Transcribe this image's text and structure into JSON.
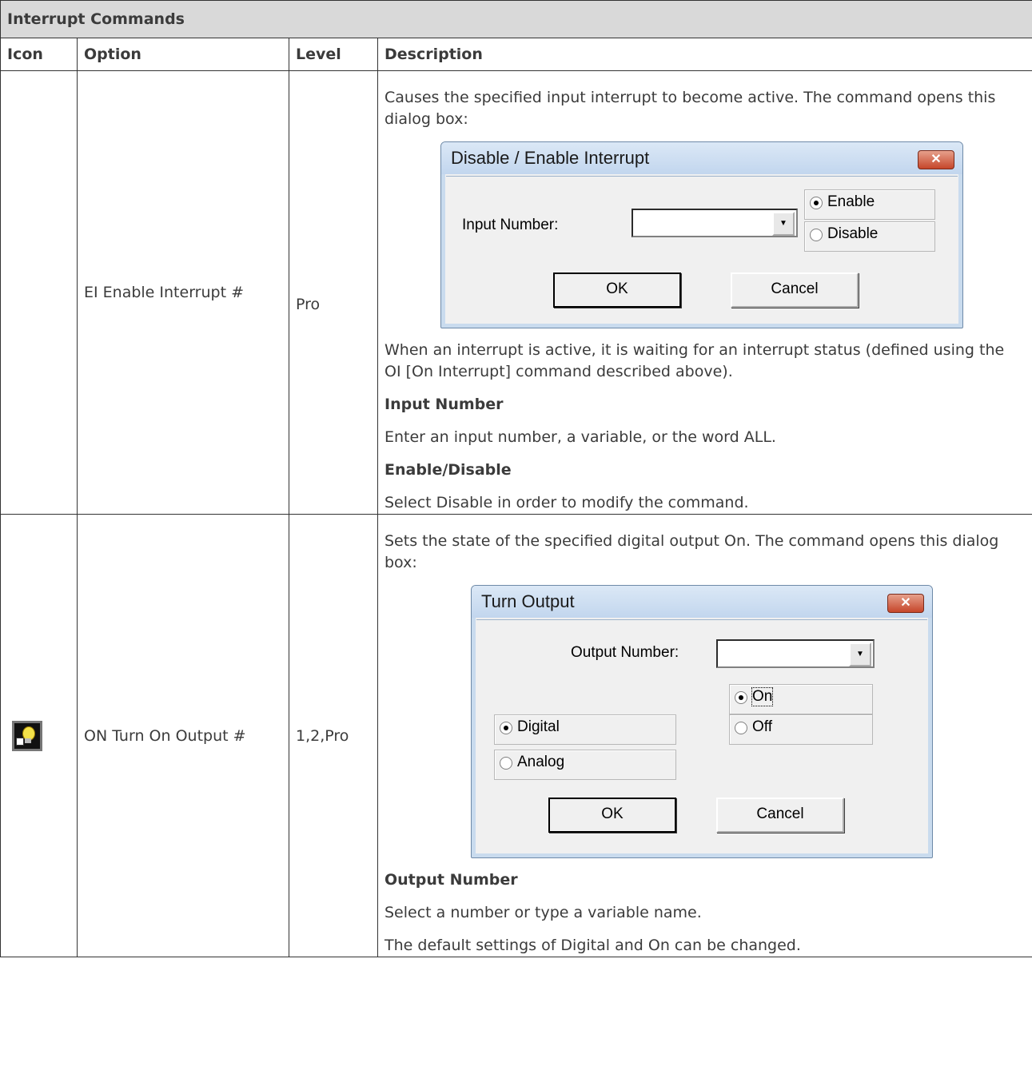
{
  "section_title": "Interrupt Commands",
  "headers": {
    "icon": "Icon",
    "option": "Option",
    "level": "Level",
    "description": "Description"
  },
  "rows": [
    {
      "option": "EI Enable Interrupt #",
      "level": "Pro",
      "intro": "Causes the specified input interrupt to become active. The command opens this dialog box:",
      "dialog": {
        "title": "Disable / Enable Interrupt",
        "close": "✕",
        "input_label": "Input Number:",
        "input_value": "",
        "enable": "Enable",
        "disable": "Disable",
        "ok": "OK",
        "cancel": "Cancel",
        "selected": "Enable"
      },
      "after": "When an interrupt is active, it is waiting for an interrupt status (defined using the OI [On Interrupt] command described above).",
      "h1": "Input Number",
      "p1": "Enter an input number, a variable, or the word ALL.",
      "h2": "Enable/Disable",
      "p2": "Select Disable in order to modify the command."
    },
    {
      "icon": "lightbulb-icon",
      "option": "ON Turn On Output #",
      "level": "1,2,Pro",
      "intro": "Sets the state of the specified digital output On. The command opens this dialog box:",
      "dialog": {
        "title": "Turn Output",
        "close": "✕",
        "output_label": "Output Number:",
        "output_value": "",
        "on": "On",
        "off": "Off",
        "digital": "Digital",
        "analog": "Analog",
        "ok": "OK",
        "cancel": "Cancel",
        "selected_state": "On",
        "selected_type": "Digital"
      },
      "h1": "Output Number",
      "p1": "Select a number or type a variable name.",
      "p2": "The default settings of Digital and On can be changed."
    }
  ]
}
